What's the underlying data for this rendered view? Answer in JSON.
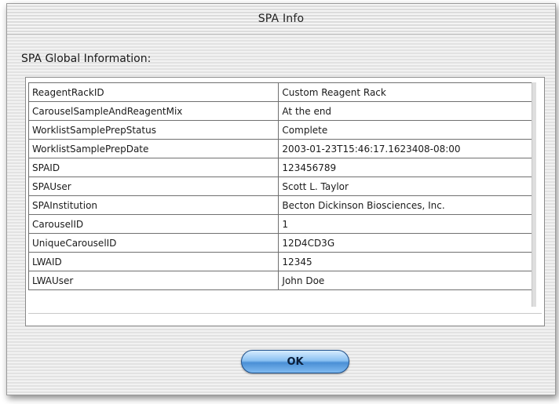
{
  "window": {
    "title": "SPA Info"
  },
  "section": {
    "label": "SPA Global Information:"
  },
  "rows": [
    {
      "key": "ReagentRackID",
      "value": "Custom Reagent Rack"
    },
    {
      "key": "CarouselSampleAndReagentMix",
      "value": "At the end"
    },
    {
      "key": "WorklistSamplePrepStatus",
      "value": "Complete"
    },
    {
      "key": "WorklistSamplePrepDate",
      "value": "2003-01-23T15:46:17.1623408-08:00"
    },
    {
      "key": "SPAID",
      "value": "123456789"
    },
    {
      "key": "SPAUser",
      "value": "Scott L. Taylor"
    },
    {
      "key": "SPAInstitution",
      "value": "Becton Dickinson Biosciences, Inc."
    },
    {
      "key": "CarouselID",
      "value": "1"
    },
    {
      "key": "UniqueCarouselID",
      "value": "12D4CD3G"
    },
    {
      "key": "LWAID",
      "value": "12345"
    },
    {
      "key": "LWAUser",
      "value": "John Doe"
    }
  ],
  "buttons": {
    "ok_label": "OK"
  },
  "colors": {
    "ok_button_accent": "#4a8fd6",
    "grid_line": "#707070"
  }
}
